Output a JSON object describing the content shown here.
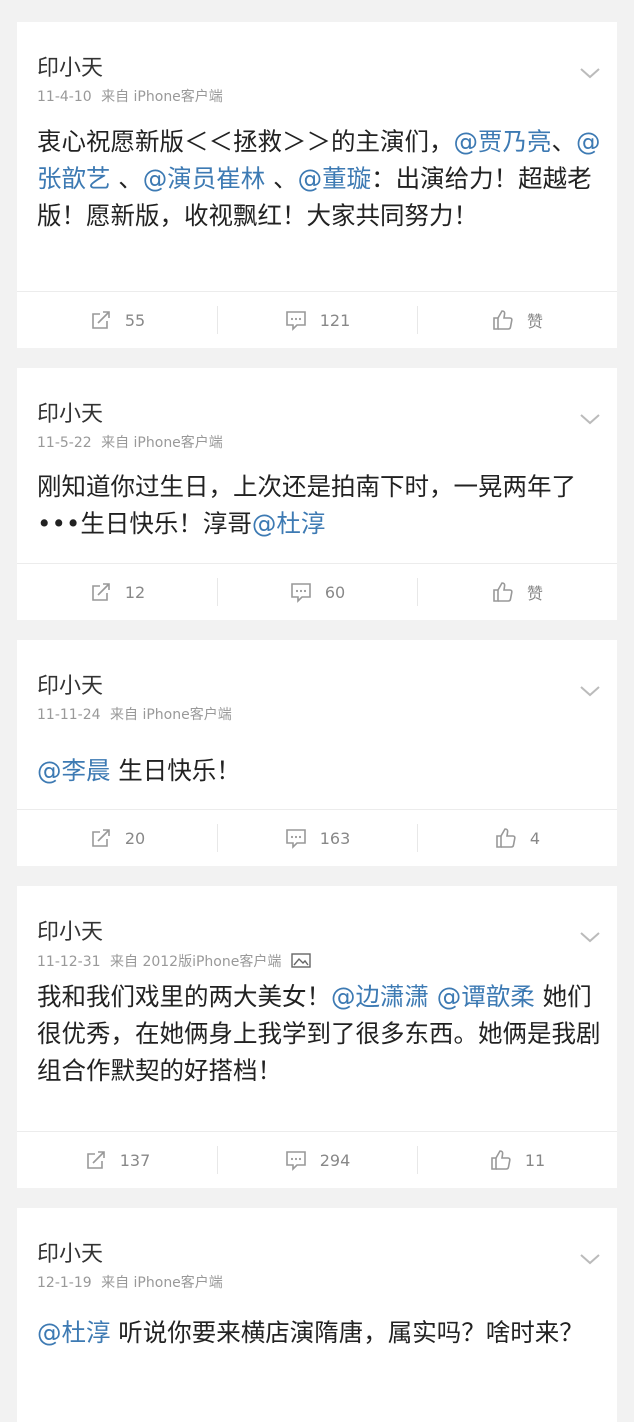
{
  "posts": [
    {
      "name": "印小天",
      "time": "11-4-10",
      "source": "来自 iPhone客户端",
      "has_image": false,
      "text": [
        {
          "t": "衷心祝愿新版＜＜拯救＞＞的主演们，",
          "at": false
        },
        {
          "t": "@贾乃亮",
          "at": true
        },
        {
          "t": "、",
          "at": false
        },
        {
          "t": "@张歆艺",
          "at": true
        },
        {
          "t": " 、",
          "at": false
        },
        {
          "t": "@演员崔林",
          "at": true
        },
        {
          "t": " 、",
          "at": false
        },
        {
          "t": "@董璇",
          "at": true
        },
        {
          "t": "：出演给力！超越老版！愿新版，收视飘红！大家共同努力！",
          "at": false
        }
      ],
      "repost": "55",
      "comment": "121",
      "like": "赞"
    },
    {
      "name": "印小天",
      "time": "11-5-22",
      "source": "来自 iPhone客户端",
      "has_image": false,
      "text": [
        {
          "t": "刚知道你过生日，上次还是拍南下时，一晃两年了•••生日快乐！淳哥",
          "at": false
        },
        {
          "t": "@杜淳",
          "at": true
        }
      ],
      "repost": "12",
      "comment": "60",
      "like": "赞"
    },
    {
      "name": "印小天",
      "time": "11-11-24",
      "source": "来自 iPhone客户端",
      "has_image": false,
      "text": [
        {
          "t": "@李晨",
          "at": true
        },
        {
          "t": " 生日快乐！",
          "at": false
        }
      ],
      "repost": "20",
      "comment": "163",
      "like": "4"
    },
    {
      "name": "印小天",
      "time": "11-12-31",
      "source": "来自 2012版iPhone客户端",
      "has_image": true,
      "text": [
        {
          "t": "我和我们戏里的两大美女！",
          "at": false
        },
        {
          "t": "@边潇潇",
          "at": true
        },
        {
          "t": " ",
          "at": false
        },
        {
          "t": "@谭歆柔",
          "at": true
        },
        {
          "t": " 她们很优秀，在她俩身上我学到了很多东西。她俩是我剧组合作默契的好搭档！",
          "at": false
        }
      ],
      "repost": "137",
      "comment": "294",
      "like": "11"
    },
    {
      "name": "印小天",
      "time": "12-1-19",
      "source": "来自 iPhone客户端",
      "has_image": false,
      "text": [
        {
          "t": "@杜淳",
          "at": true
        },
        {
          "t": " 听说你要来横店演隋唐，属实吗？啥时来？",
          "at": false
        }
      ],
      "repost": "",
      "comment": "",
      "like": ""
    }
  ]
}
